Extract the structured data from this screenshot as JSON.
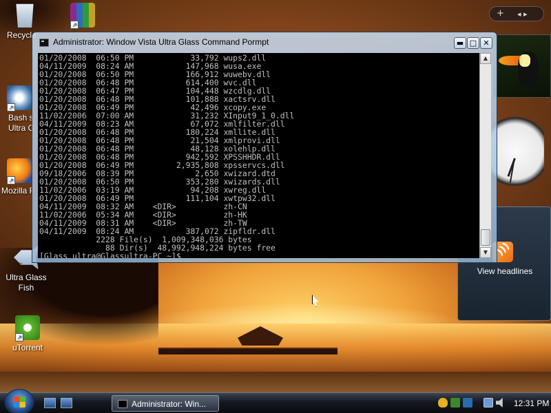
{
  "desktop": {
    "icons": [
      {
        "label": "Recycle",
        "icon": "recycle-bin-icon"
      },
      {
        "label": "",
        "icon": "winrar-archive-icon"
      },
      {
        "label": "Bash s\nUltra G",
        "icon": "bash-shell-icon"
      },
      {
        "label": "Mozilla F",
        "icon": "firefox-icon"
      },
      {
        "label": "Ultra Glass\nFish",
        "icon": "fish-icon"
      },
      {
        "label": "uTorrent",
        "icon": "utorrent-icon"
      }
    ]
  },
  "sidebar": {
    "add_label": "+",
    "nav_label": "◂ ▸",
    "feed_label": "View headlines"
  },
  "console_window": {
    "title": "Administrator:  Window Vista Ultra Glass Command Pormpt",
    "minimize_label": "▬",
    "maximize_label": "□",
    "close_label": "✕",
    "lines": [
      "01/20/2008  06:50 PM            33,792 wups2.dll",
      "04/11/2009  08:24 AM           147,968 wusa.exe",
      "01/20/2008  06:50 PM           166,912 wuwebv.dll",
      "01/20/2008  06:48 PM           614,400 wvc.dll",
      "01/20/2008  06:47 PM           104,448 wzcdlg.dll",
      "01/20/2008  06:48 PM           101,888 xactsrv.dll",
      "01/20/2008  06:49 PM            42,496 xcopy.exe",
      "11/02/2006  07:00 AM            31,232 XInput9_1_0.dll",
      "04/11/2009  08:23 AM            67,072 xmlfilter.dll",
      "01/20/2008  06:48 PM           180,224 xmllite.dll",
      "01/20/2008  06:48 PM            21,504 xmlprovi.dll",
      "01/20/2008  06:48 PM            48,128 xolehlp.dll",
      "01/20/2008  06:48 PM           942,592 XPSSHHDR.dll",
      "01/20/2008  06:49 PM         2,935,808 xpsservcs.dll",
      "09/18/2006  08:39 PM             2,650 xwizard.dtd",
      "01/20/2008  06:50 PM           353,280 xwizards.dll",
      "11/02/2006  03:19 AM            94,208 xwreg.dll",
      "01/20/2008  06:49 PM           111,104 xwtpw32.dll",
      "04/11/2009  08:32 AM    <DIR>          zh-CN",
      "11/02/2006  05:34 AM    <DIR>          zh-HK",
      "04/11/2009  08:31 AM    <DIR>          zh-TW",
      "04/11/2009  08:24 AM           387,072 zipfldr.dll",
      "            2228 File(s)  1,009,348,036 bytes",
      "              88 Dir(s)  48,992,948,224 bytes free"
    ],
    "prompt": "[Glass ultra@Glassultra-PC ~]$ "
  },
  "taskbar": {
    "task_label": "Administrator:  Win...",
    "clock": "12:31 PM"
  },
  "colors": {
    "console_bg": "#000000",
    "console_fg": "#c0c0c0",
    "taskbar_bg": "#141820"
  }
}
